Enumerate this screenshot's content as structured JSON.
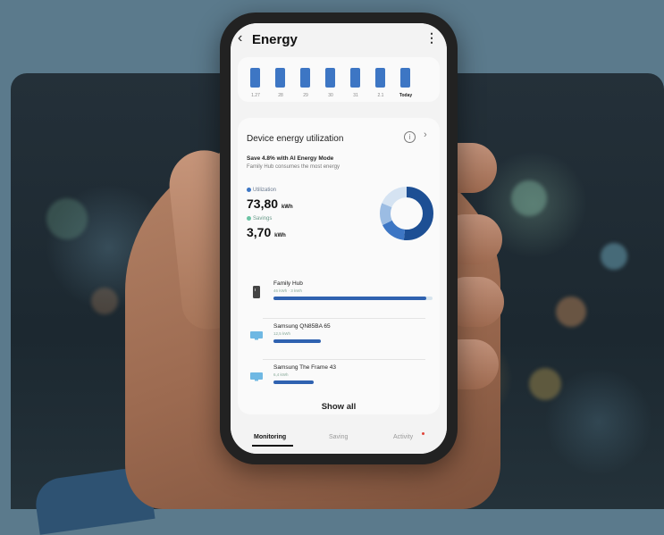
{
  "header": {
    "title": "Energy",
    "back_icon": "chevron-left-icon",
    "more_icon": "more-vertical-icon"
  },
  "weekly_chart": {
    "type": "bar",
    "bar_color": "#3d76c4",
    "labels": [
      "1.27",
      "28",
      "29",
      "30",
      "31",
      "2.1",
      "Today"
    ],
    "highlighted_label": "Today"
  },
  "device_card": {
    "title": "Device energy utilization",
    "info_icon": "info-icon",
    "chevron_icon": "chevron-right-icon",
    "save_text": "Save 4.8% with AI Energy Mode",
    "consume_text": "Family Hub consumes the most energy",
    "utilization_label": "Utilization",
    "utilization_value": "73,80",
    "utilization_unit": "kWh",
    "savings_label": "Savings",
    "savings_value": "3,70",
    "savings_unit": "kWh",
    "donut_colors": [
      "#1d4f94",
      "#3d76c4",
      "#9bbce3",
      "#d5e3f2"
    ],
    "devices": [
      {
        "name": "Family Hub",
        "sub": "46 kWh  ·  3 kWh",
        "icon": "fridge-icon",
        "share": 0.96
      },
      {
        "name": "Samsung QN85BA 65",
        "sub": "12,5 kWh",
        "icon": "tv-icon",
        "share": 0.3
      },
      {
        "name": "Samsung The Frame 43",
        "sub": "6,4 kWh",
        "icon": "tv-icon",
        "share": 0.25
      }
    ],
    "show_all": "Show all"
  },
  "bottom_nav": {
    "items": [
      "Monitoring",
      "Saving",
      "Activity"
    ],
    "active": "Monitoring"
  }
}
